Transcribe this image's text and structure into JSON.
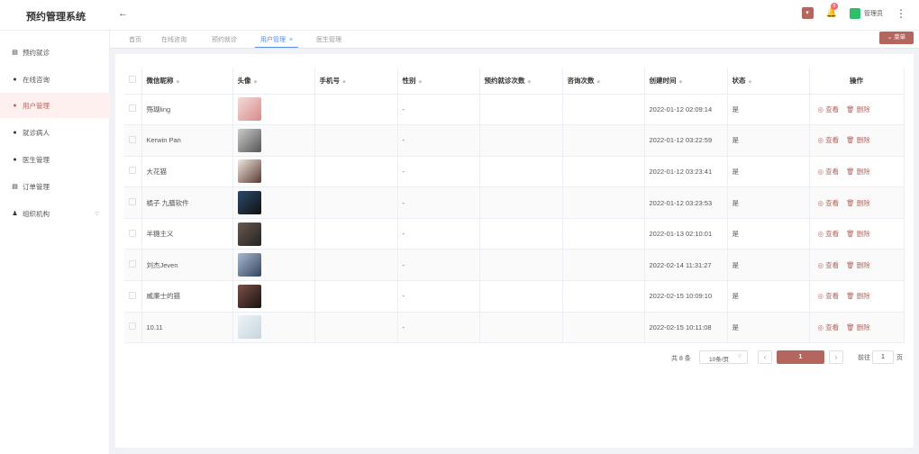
{
  "app": {
    "title": "预约管理系统",
    "back_icon": "arrow-left-icon"
  },
  "header": {
    "notification_count": "0",
    "user_name": "管理员",
    "accent": "#b4665e"
  },
  "sidebar": {
    "items": [
      {
        "label": "预约就诊",
        "icon": "list-icon"
      },
      {
        "label": "在线咨询",
        "icon": "location-icon"
      },
      {
        "label": "用户管理",
        "icon": "user-icon",
        "active": true
      },
      {
        "label": "就诊病人",
        "icon": "people-icon"
      },
      {
        "label": "医生管理",
        "icon": "doctor-icon"
      },
      {
        "label": "订单管理",
        "icon": "order-icon"
      },
      {
        "label": "组织机构",
        "icon": "org-icon"
      }
    ]
  },
  "tabs": [
    {
      "label": "首页"
    },
    {
      "label": "在线咨询"
    },
    {
      "label": "预约就诊"
    },
    {
      "label": "用户管理",
      "active": true
    },
    {
      "label": "医生管理"
    }
  ],
  "tab_action": {
    "label": "菜单"
  },
  "table": {
    "columns": [
      "微信昵称",
      "头像",
      "手机号",
      "性别",
      "预约就诊次数",
      "咨询次数",
      "创建时间",
      "状态",
      "操作"
    ],
    "rows": [
      {
        "nickname": "殇瑚ling",
        "phone": "",
        "gender": "-",
        "appt": "",
        "consult": "",
        "created": "2022-01-12 02:09:14",
        "status": "是",
        "view": "查看",
        "delete": "删除"
      },
      {
        "nickname": "Kerwin Pan",
        "phone": "",
        "gender": "-",
        "appt": "",
        "consult": "",
        "created": "2022-01-12 03:22:59",
        "status": "是",
        "view": "查看",
        "delete": "删除"
      },
      {
        "nickname": "大花猫",
        "phone": "",
        "gender": "-",
        "appt": "",
        "consult": "",
        "created": "2022-01-12 03:23:41",
        "status": "是",
        "view": "查看",
        "delete": "删除"
      },
      {
        "nickname": "橘子 九膳软件",
        "phone": "",
        "gender": "-",
        "appt": "",
        "consult": "",
        "created": "2022-01-12 03:23:53",
        "status": "是",
        "view": "查看",
        "delete": "删除"
      },
      {
        "nickname": "半糖主义",
        "phone": "",
        "gender": "-",
        "appt": "",
        "consult": "",
        "created": "2022-01-13 02:10:01",
        "status": "是",
        "view": "查看",
        "delete": "删除"
      },
      {
        "nickname": "刘杰Jeven",
        "phone": "",
        "gender": "-",
        "appt": "",
        "consult": "",
        "created": "2022-02-14 11:31:27",
        "status": "是",
        "view": "查看",
        "delete": "删除"
      },
      {
        "nickname": "威廉士的猫",
        "phone": "",
        "gender": "-",
        "appt": "",
        "consult": "",
        "created": "2022-02-15 10:09:10",
        "status": "是",
        "view": "查看",
        "delete": "删除"
      },
      {
        "nickname": "10.11",
        "phone": "",
        "gender": "-",
        "appt": "",
        "consult": "",
        "created": "2022-02-15 10:11:08",
        "status": "是",
        "view": "查看",
        "delete": "删除"
      }
    ]
  },
  "pagination": {
    "total": "共 8 条",
    "page_size": "10条/页",
    "current": "1",
    "jump_prefix": "前往",
    "jump_value": "1",
    "jump_suffix": "页"
  }
}
